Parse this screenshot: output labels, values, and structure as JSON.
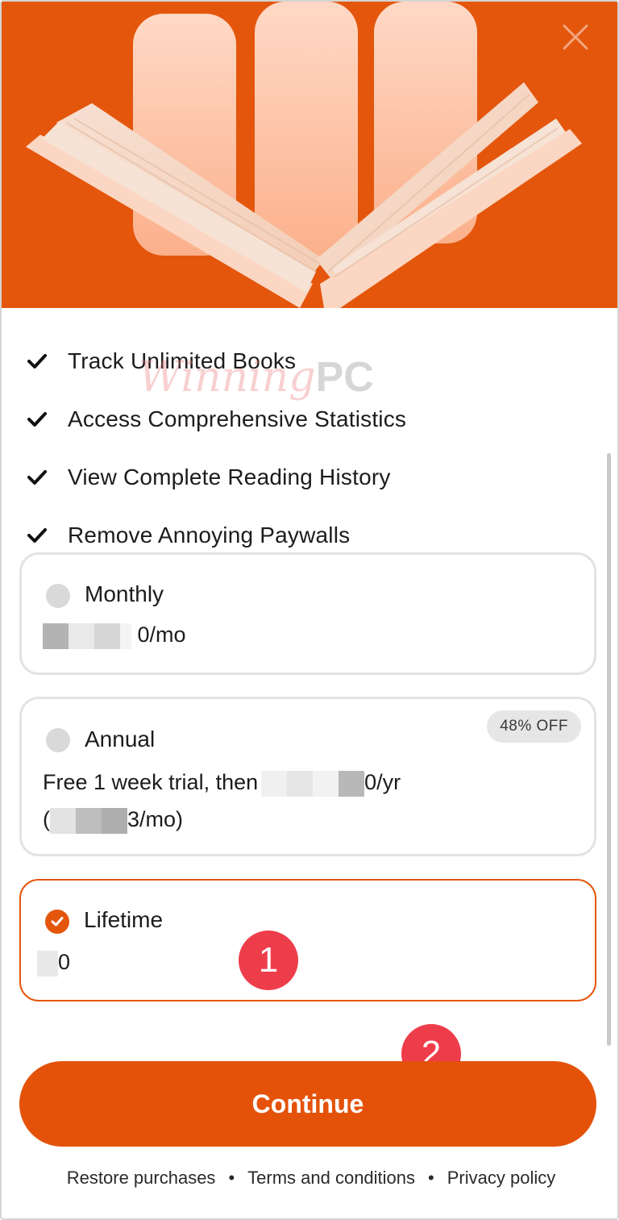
{
  "colors": {
    "accent": "#e4560c",
    "step_badge": "#ee3d4a"
  },
  "icons": {
    "close": "close-icon",
    "check": "checkmark-icon",
    "radio_checked": "check-circle-icon"
  },
  "features": [
    "Track Unlimited Books",
    "Access Comprehensive Statistics",
    "View Complete Reading History",
    "Remove Annoying Paywalls"
  ],
  "watermark": {
    "script": "Winning",
    "pc": "PC"
  },
  "plans": {
    "monthly": {
      "name": "Monthly",
      "price_suffix": "0/mo",
      "selected": false
    },
    "annual": {
      "name": "Annual",
      "badge": "48% OFF",
      "price_prefix": "Free 1 week trial, then",
      "price_suffix": "0/yr",
      "sub_prefix": "(",
      "sub_suffix": "3/mo)",
      "selected": false
    },
    "lifetime": {
      "name": "Lifetime",
      "price_suffix": "0",
      "selected": true
    }
  },
  "steps": [
    "1",
    "2"
  ],
  "continue_label": "Continue",
  "footer": {
    "restore": "Restore purchases",
    "terms": "Terms and conditions",
    "privacy": "Privacy policy",
    "separator": "•"
  }
}
